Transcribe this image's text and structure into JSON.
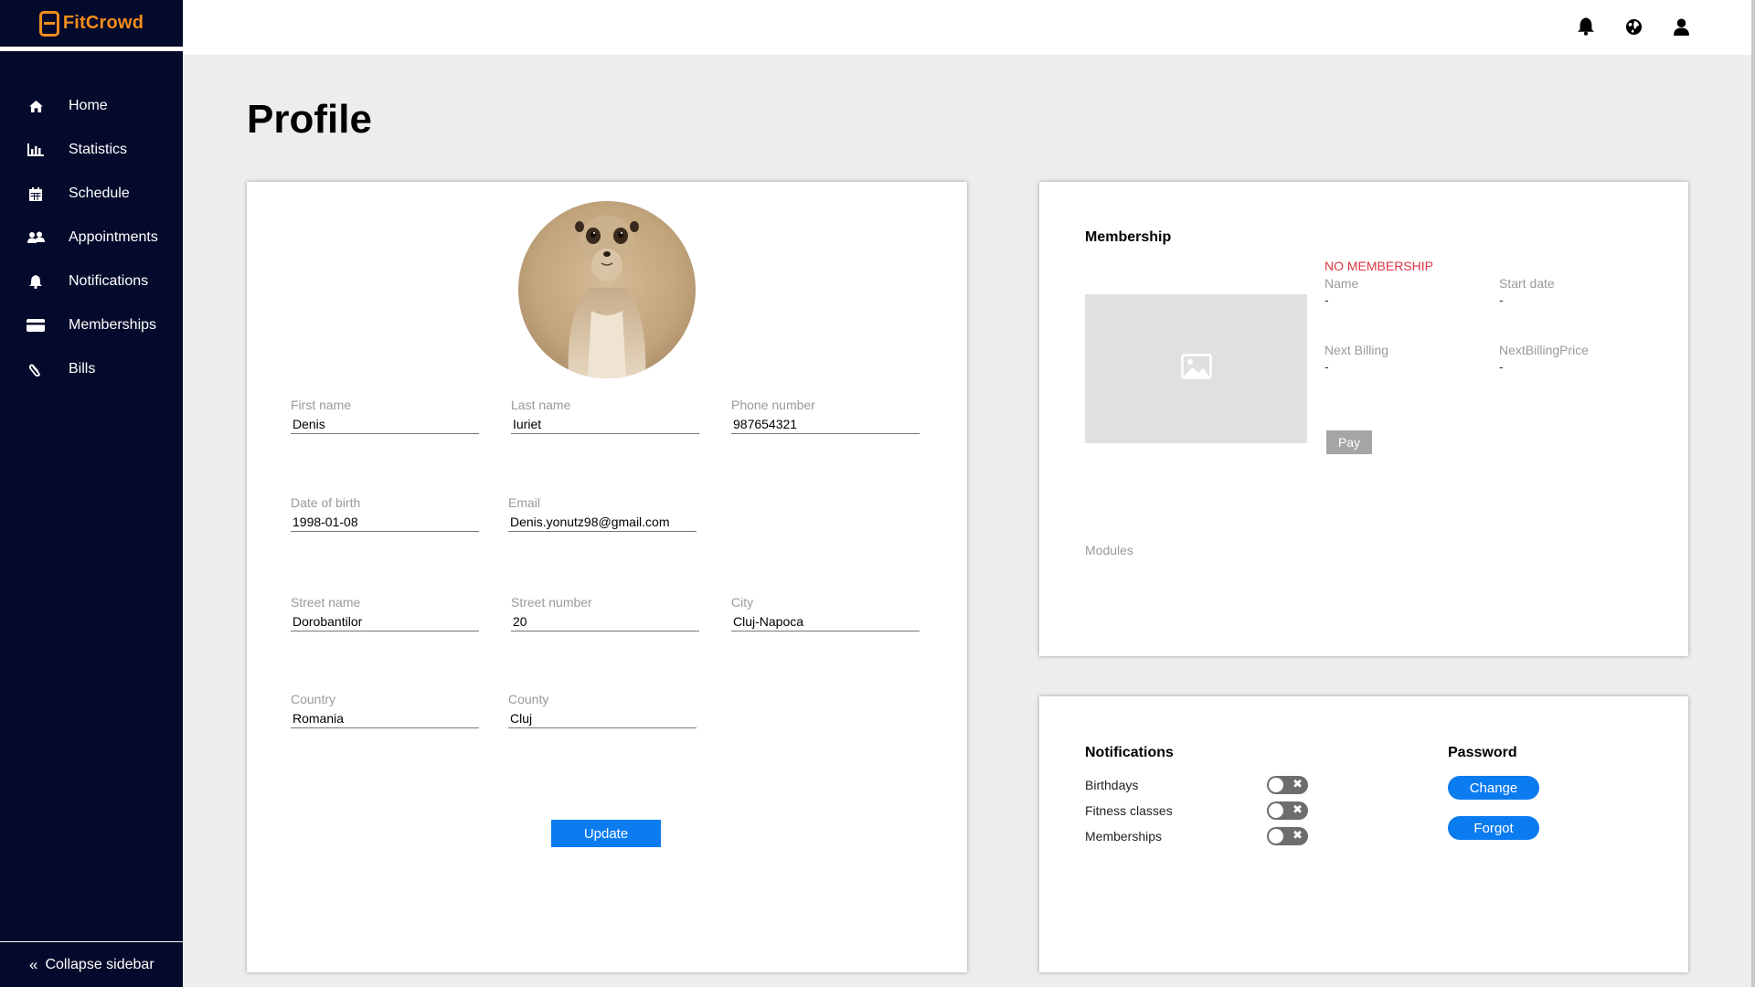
{
  "brand": {
    "name": "FitCrowd",
    "accent": "#f28c1b"
  },
  "sidebar": {
    "items": [
      {
        "label": "Home",
        "icon": "home-icon"
      },
      {
        "label": "Statistics",
        "icon": "bar-chart-icon"
      },
      {
        "label": "Schedule",
        "icon": "calendar-icon"
      },
      {
        "label": "Appointments",
        "icon": "users-icon"
      },
      {
        "label": "Notifications",
        "icon": "bell-icon"
      },
      {
        "label": "Memberships",
        "icon": "credit-card-icon"
      },
      {
        "label": "Bills",
        "icon": "paperclip-icon"
      }
    ],
    "collapse_label": "Collapse sidebar"
  },
  "topbar": {
    "icons": [
      "bell-icon",
      "globe-icon",
      "user-icon"
    ]
  },
  "page": {
    "title": "Profile"
  },
  "profile": {
    "first_name": {
      "label": "First name",
      "value": "Denis"
    },
    "last_name": {
      "label": "Last name",
      "value": "Iuriet"
    },
    "phone": {
      "label": "Phone number",
      "value": "987654321"
    },
    "dob": {
      "label": "Date of birth",
      "value": "1998-01-08"
    },
    "email": {
      "label": "Email",
      "value": "Denis.yonutz98@gmail.com"
    },
    "street_name": {
      "label": "Street name",
      "value": "Dorobantilor"
    },
    "street_number": {
      "label": "Street number",
      "value": "20"
    },
    "city": {
      "label": "City",
      "value": "Cluj-Napoca"
    },
    "country": {
      "label": "Country",
      "value": "Romania"
    },
    "county": {
      "label": "County",
      "value": "Cluj"
    },
    "update_label": "Update"
  },
  "membership": {
    "title": "Membership",
    "status": "NO MEMBERSHIP",
    "name": {
      "label": "Name",
      "value": "-"
    },
    "start_date": {
      "label": "Start date",
      "value": "-"
    },
    "next_billing": {
      "label": "Next Billing",
      "value": "-"
    },
    "next_billing_price": {
      "label": "NextBillingPrice",
      "value": "-"
    },
    "pay_label": "Pay",
    "modules_label": "Modules"
  },
  "notifications": {
    "title": "Notifications",
    "toggles": [
      {
        "label": "Birthdays",
        "enabled": false
      },
      {
        "label": "Fitness classes",
        "enabled": false
      },
      {
        "label": "Memberships",
        "enabled": false
      }
    ]
  },
  "password": {
    "title": "Password",
    "change_label": "Change",
    "forgot_label": "Forgot"
  },
  "colors": {
    "sidebar_bg": "#040a2b",
    "primary": "#0b7bf0",
    "danger": "#dc3545"
  }
}
